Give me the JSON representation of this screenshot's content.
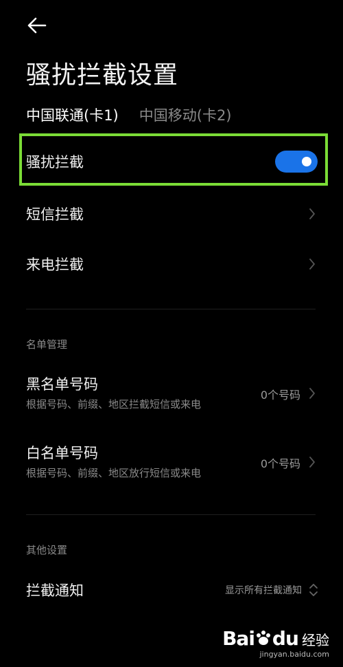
{
  "header": {
    "title": "骚扰拦截设置"
  },
  "tabs": [
    {
      "label": "中国联通(卡1)",
      "active": true
    },
    {
      "label": "中国移动(卡2)",
      "active": false
    }
  ],
  "main": {
    "spam_block": {
      "label": "骚扰拦截",
      "enabled": true
    },
    "sms_block": {
      "label": "短信拦截"
    },
    "call_block": {
      "label": "来电拦截"
    }
  },
  "list_management": {
    "section_title": "名单管理",
    "blacklist": {
      "title": "黑名单号码",
      "subtitle": "根据号码、前缀、地区拦截短信或来电",
      "count": "0个号码"
    },
    "whitelist": {
      "title": "白名单号码",
      "subtitle": "根据号码、前缀、地区放行短信或来电",
      "count": "0个号码"
    }
  },
  "other_settings": {
    "section_title": "其他设置",
    "notification": {
      "label": "拦截通知",
      "value": "显示所有拦截通知"
    }
  },
  "watermark": {
    "brand_left": "Bai",
    "brand_right": "du",
    "jingyan": "经验",
    "url": "jingyan.baidu.com"
  },
  "colors": {
    "accent": "#1a73e8",
    "highlight": "#7bdc36",
    "background": "#000000"
  }
}
